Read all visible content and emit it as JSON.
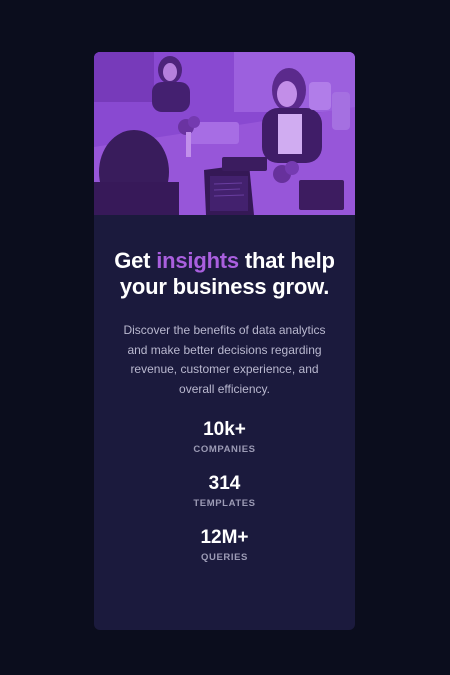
{
  "hero_image": {
    "icon": "office-photo-image",
    "tint": "#a855f7"
  },
  "headline": {
    "before": "Get ",
    "highlight": "insights",
    "after": " that help your business grow."
  },
  "description": "Discover the benefits of data analytics and make better decisions regarding revenue, customer experience, and overall efficiency.",
  "stats": [
    {
      "value": "10k+",
      "label": "COMPANIES"
    },
    {
      "value": "314",
      "label": "TEMPLATES"
    },
    {
      "value": "12M+",
      "label": "QUERIES"
    }
  ],
  "colors": {
    "page_background": "#0b0d1d",
    "card_background": "#1b1a3d",
    "accent": "#a95fde",
    "heading": "#ffffff",
    "body_text": "#b9b8cf",
    "stat_label": "#9c9bb5"
  }
}
